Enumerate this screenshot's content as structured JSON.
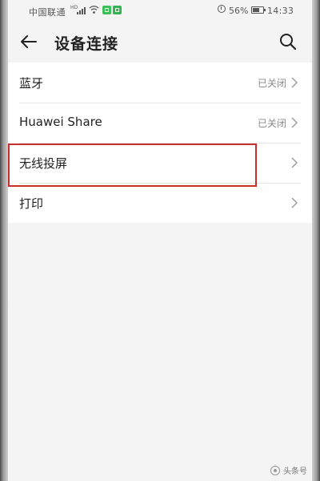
{
  "status_bar": {
    "carrier": "中国联通",
    "battery_percent": "56%",
    "time": "14:33",
    "icons": [
      "signal-icon",
      "wifi-icon",
      "app-badge-icon",
      "app-badge-icon",
      "alarm-icon",
      "battery-icon"
    ]
  },
  "header": {
    "title": "设备连接",
    "back_icon": "back-arrow-icon",
    "search_icon": "search-icon"
  },
  "list": {
    "items": [
      {
        "label": "蓝牙",
        "value": "已关闭"
      },
      {
        "label": "Huawei Share",
        "value": "已关闭"
      },
      {
        "label": "无线投屏",
        "value": ""
      },
      {
        "label": "打印",
        "value": ""
      }
    ]
  },
  "annotation": {
    "highlight_color": "#c8302f",
    "highlighted_item": "无线投屏"
  },
  "watermark": {
    "text": "头条号"
  },
  "colors": {
    "background": "#f4f4f4",
    "list_background": "#ffffff",
    "secondary_text": "#8a8a8a",
    "primary_text": "#222222"
  }
}
